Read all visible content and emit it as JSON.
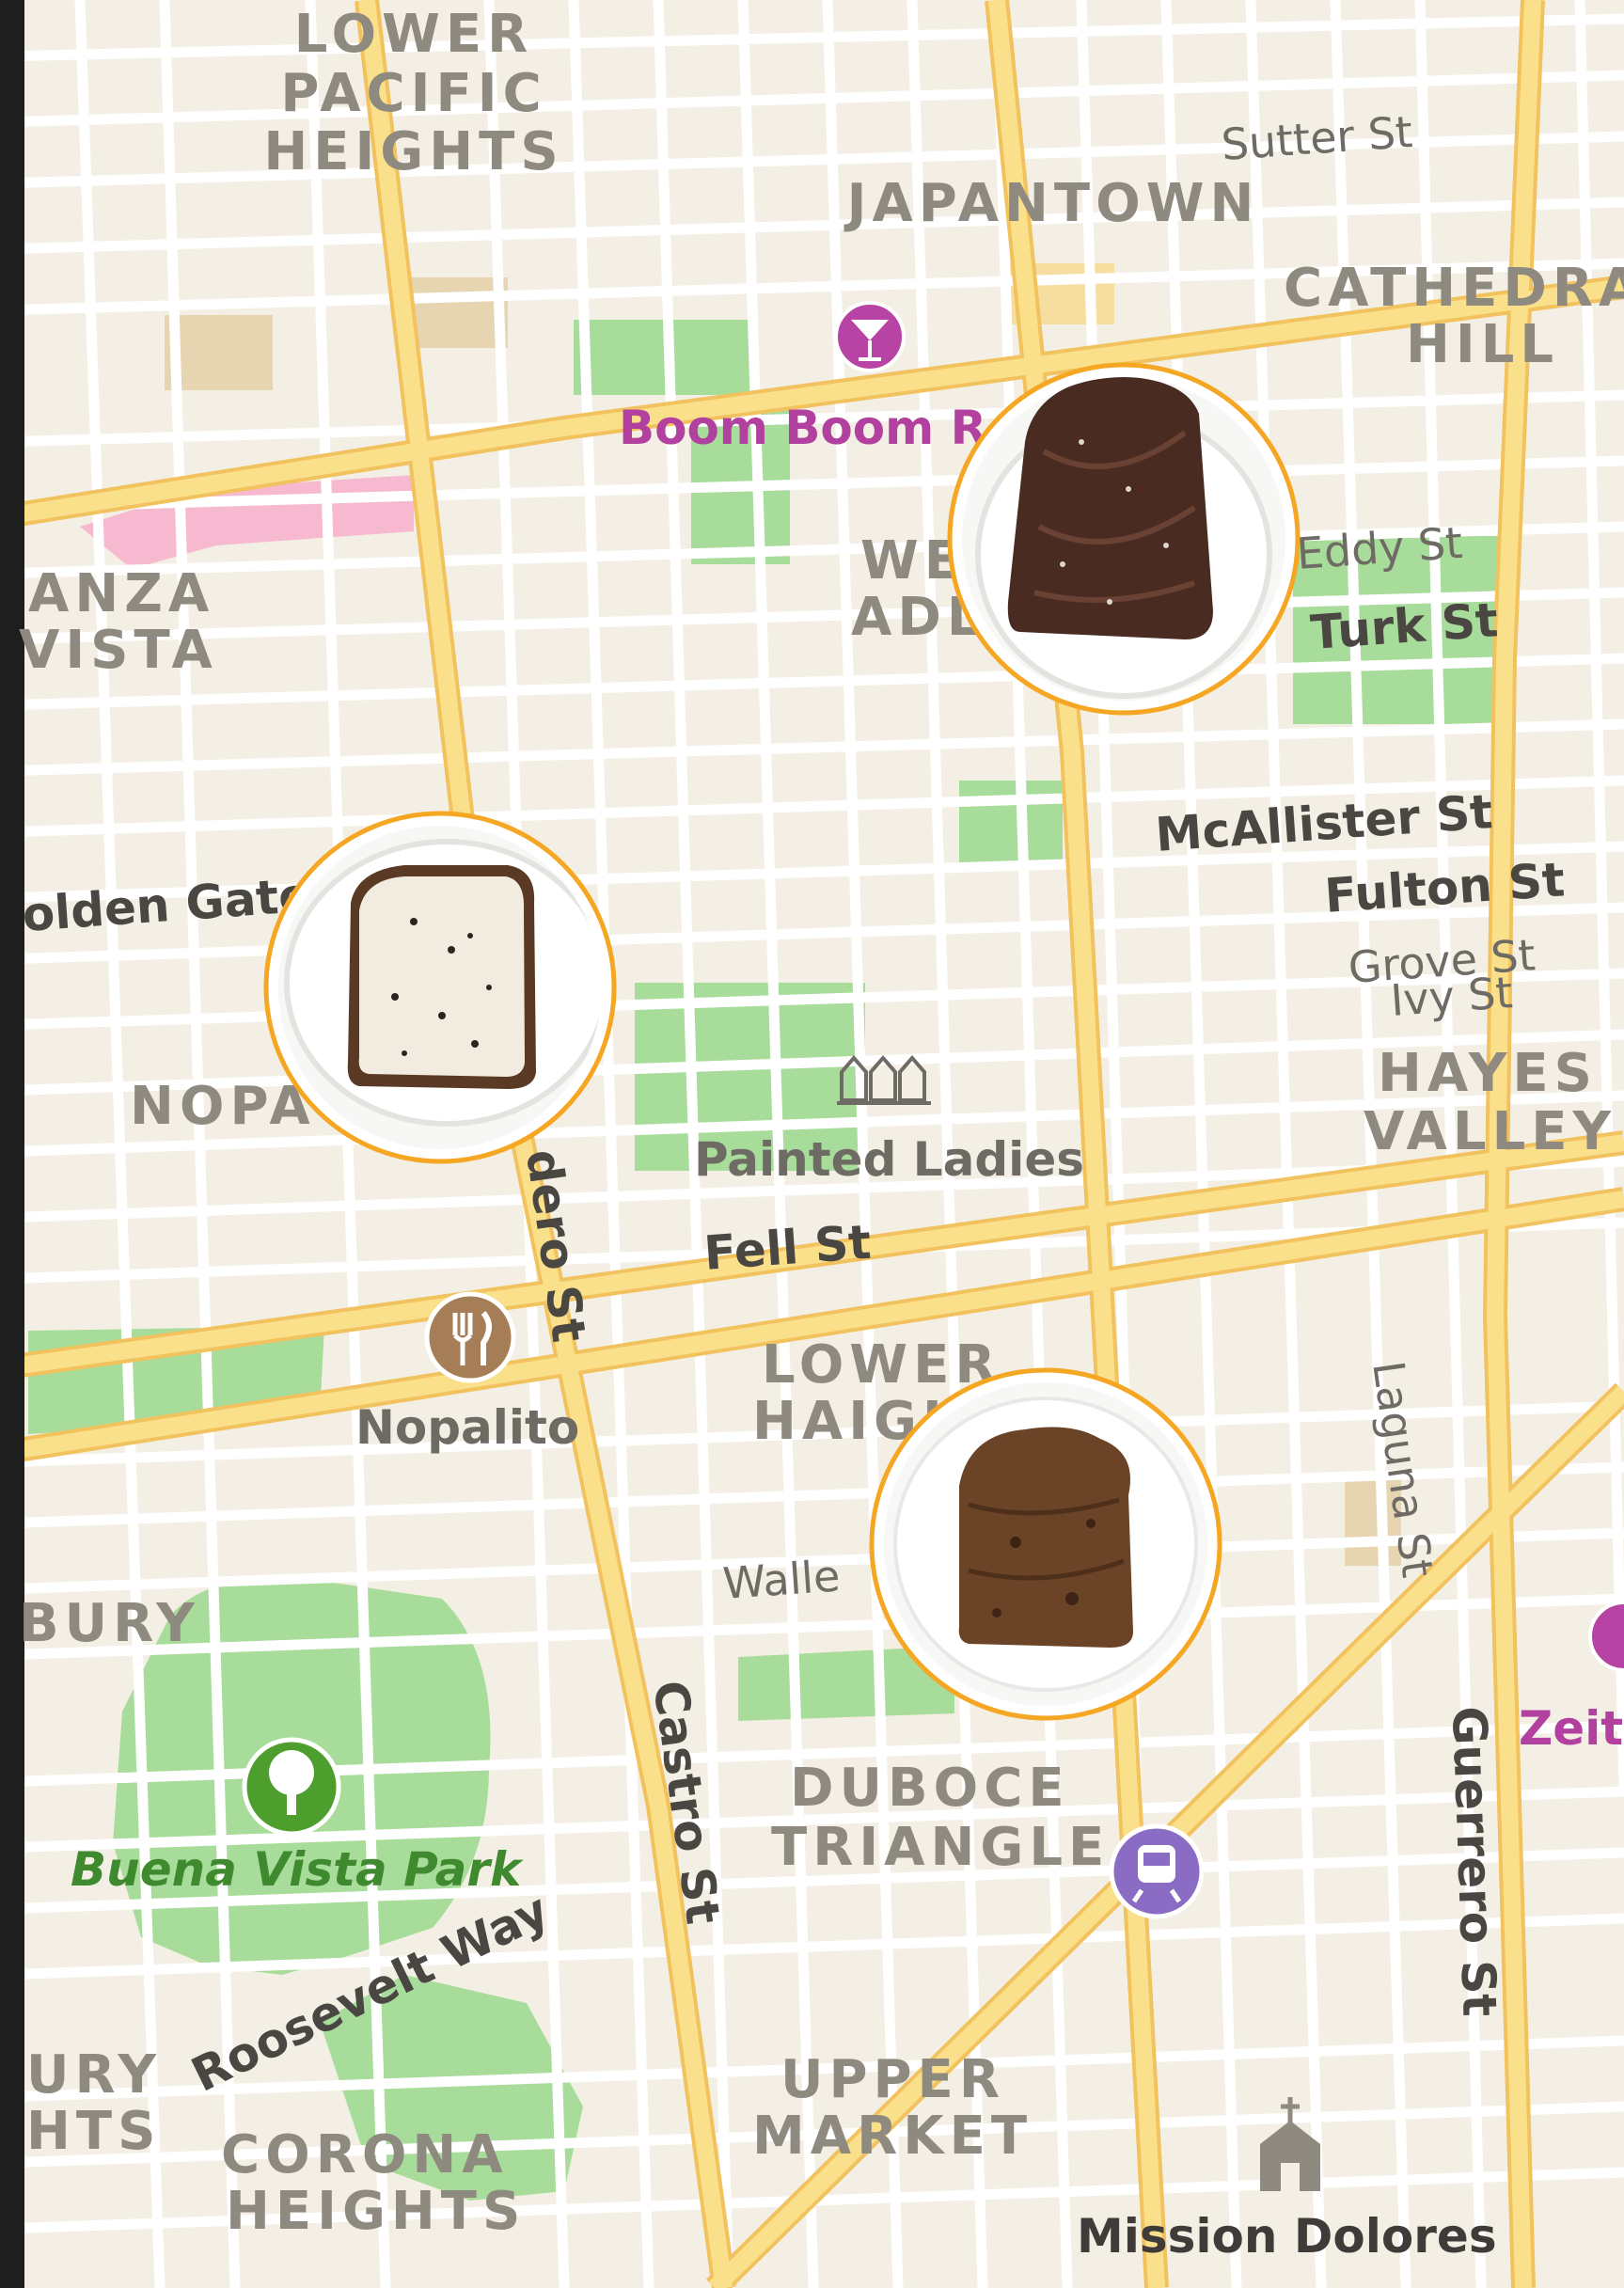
{
  "map": {
    "colors": {
      "land": "#f4efe4",
      "minor_road": "#ffffff",
      "major_road": "#fbe08b",
      "major_road_edge": "#f1c25e",
      "park": "#a8dc9a",
      "block_tan": "#e6d5b0",
      "block_pink": "#f7b9d0",
      "block_yellow": "#f6dea0",
      "pin_border": "#f5a623",
      "poi_purple": "#b744a4",
      "transit_purple": "#8a6cc4",
      "food_brown": "#a57d56",
      "park_icon_green": "#4e9e2e"
    },
    "neighborhoods": {
      "lower_pacific_1": "LOWER",
      "lower_pacific_2": "PACIFIC",
      "lower_pacific_3": "HEIGHTS",
      "japantown": "JAPANTOWN",
      "cathedral_1": "CATHEDRA",
      "cathedral_2": "HILL",
      "anza_1": "ANZA",
      "anza_2": "VISTA",
      "western_1": "WE",
      "western_2": "ADL",
      "nopa": "NOPA",
      "hayes_1": "HAYES",
      "hayes_2": "VALLEY",
      "lower_haight_1": "LOWER",
      "lower_haight_2": "HAIGH",
      "ashbury": "BURY",
      "duboce_1": "DUBOCE",
      "duboce_2": "TRIANGLE",
      "upper_market_1": "UPPER",
      "upper_market_2": "MARKET",
      "corona_1": "CORONA",
      "corona_2": "HEIGHTS",
      "ashbury_heights_1": "URY",
      "ashbury_heights_2": "HTS"
    },
    "streets": {
      "sutter": "Sutter St",
      "eddy": "Eddy St",
      "turk": "Turk St",
      "mcallister": "McAllister St",
      "fulton": "Fulton St",
      "grove": "Grove St",
      "ivy": "Ivy St",
      "golden_gate": "olden Gate",
      "divisadero": "dero St",
      "fell": "Fell St",
      "laguna": "Laguna St",
      "waller": "Walle",
      "castro": "Castro St",
      "guerrero": "Guerrero St",
      "roosevelt": "Roosevelt Way"
    },
    "pois": {
      "boom_boom": "Boom Boom R",
      "painted_ladies": "Painted Ladies",
      "nopalito": "Nopalito",
      "buena_vista": "Buena Vista Park",
      "mission_dolores": "Mission Dolores",
      "zeitgeist": "Zeit"
    },
    "pins": [
      {
        "name": "chocolate-spread-toast",
        "toast": "dark chocolate spread with sea salt"
      },
      {
        "name": "butter-pepper-toast",
        "toast": "butter with cracked pepper"
      },
      {
        "name": "plain-toast",
        "toast": "plain toasted bread"
      }
    ]
  }
}
